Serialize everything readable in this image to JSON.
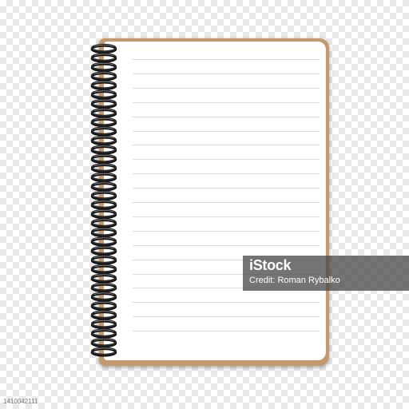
{
  "watermark": {
    "brand": "iStock",
    "credit": "Credit: Roman Rybalko"
  },
  "image_id": "1410042111",
  "notebook": {
    "ruled_lines": 20,
    "spiral_rings": 34,
    "colors": {
      "cover": "#c49a6c",
      "page": "#ffffff",
      "rule": "#d6dbe2",
      "spiral": "#2b2b2b"
    }
  }
}
